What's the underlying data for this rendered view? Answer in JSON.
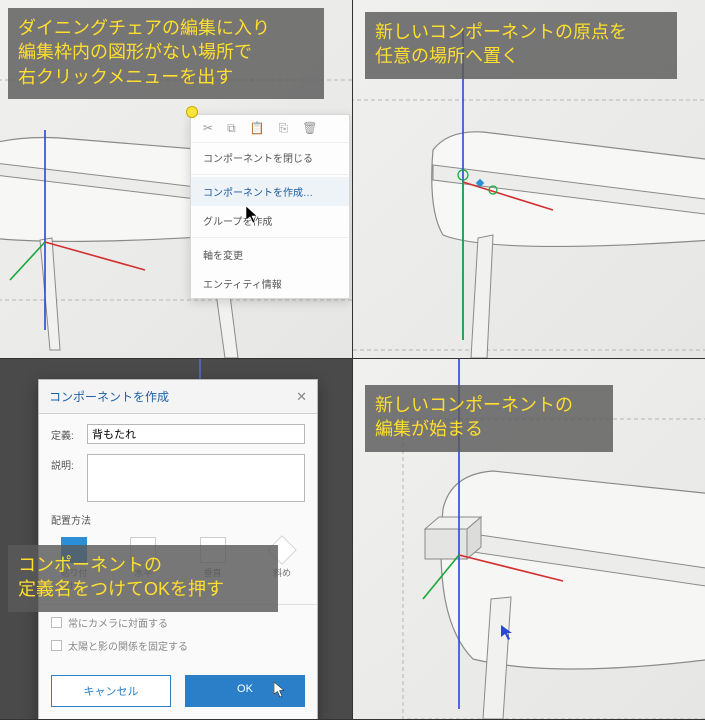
{
  "panel1": {
    "caption": "ダイニングチェアの編集に入り\n編集枠内の図形がない場所で\n右クリックメニューを出す",
    "menu": {
      "icons": [
        "cut-icon",
        "copy-icon",
        "paste-icon",
        "paste-in-place-icon",
        "delete-icon"
      ],
      "close_component": "コンポーネントを閉じる",
      "create_component": "コンポーネントを作成…",
      "create_group": "グループを作成",
      "change_axes": "軸を変更",
      "entity_info": "エンティティ情報"
    }
  },
  "panel2": {
    "caption": "新しいコンポーネントの原点を\n任意の場所へ置く"
  },
  "panel3": {
    "caption": "コンポーネントの\n定義名をつけてOKを押す",
    "dialog": {
      "title": "コンポーネントを作成",
      "def_label": "定義:",
      "def_value": "背もたれ",
      "desc_label": "説明:",
      "desc_value": "",
      "placement_label": "配置方法",
      "align_opts": [
        "貼り付け：",
        "水平",
        "垂直",
        "斜め"
      ],
      "chk_face_camera": "常にカメラに対面する",
      "chk_shadow": "太陽と影の関係を固定する",
      "cancel": "キャンセル",
      "ok": "OK"
    }
  },
  "panel4": {
    "caption": "新しいコンポーネントの\n編集が始まる"
  }
}
